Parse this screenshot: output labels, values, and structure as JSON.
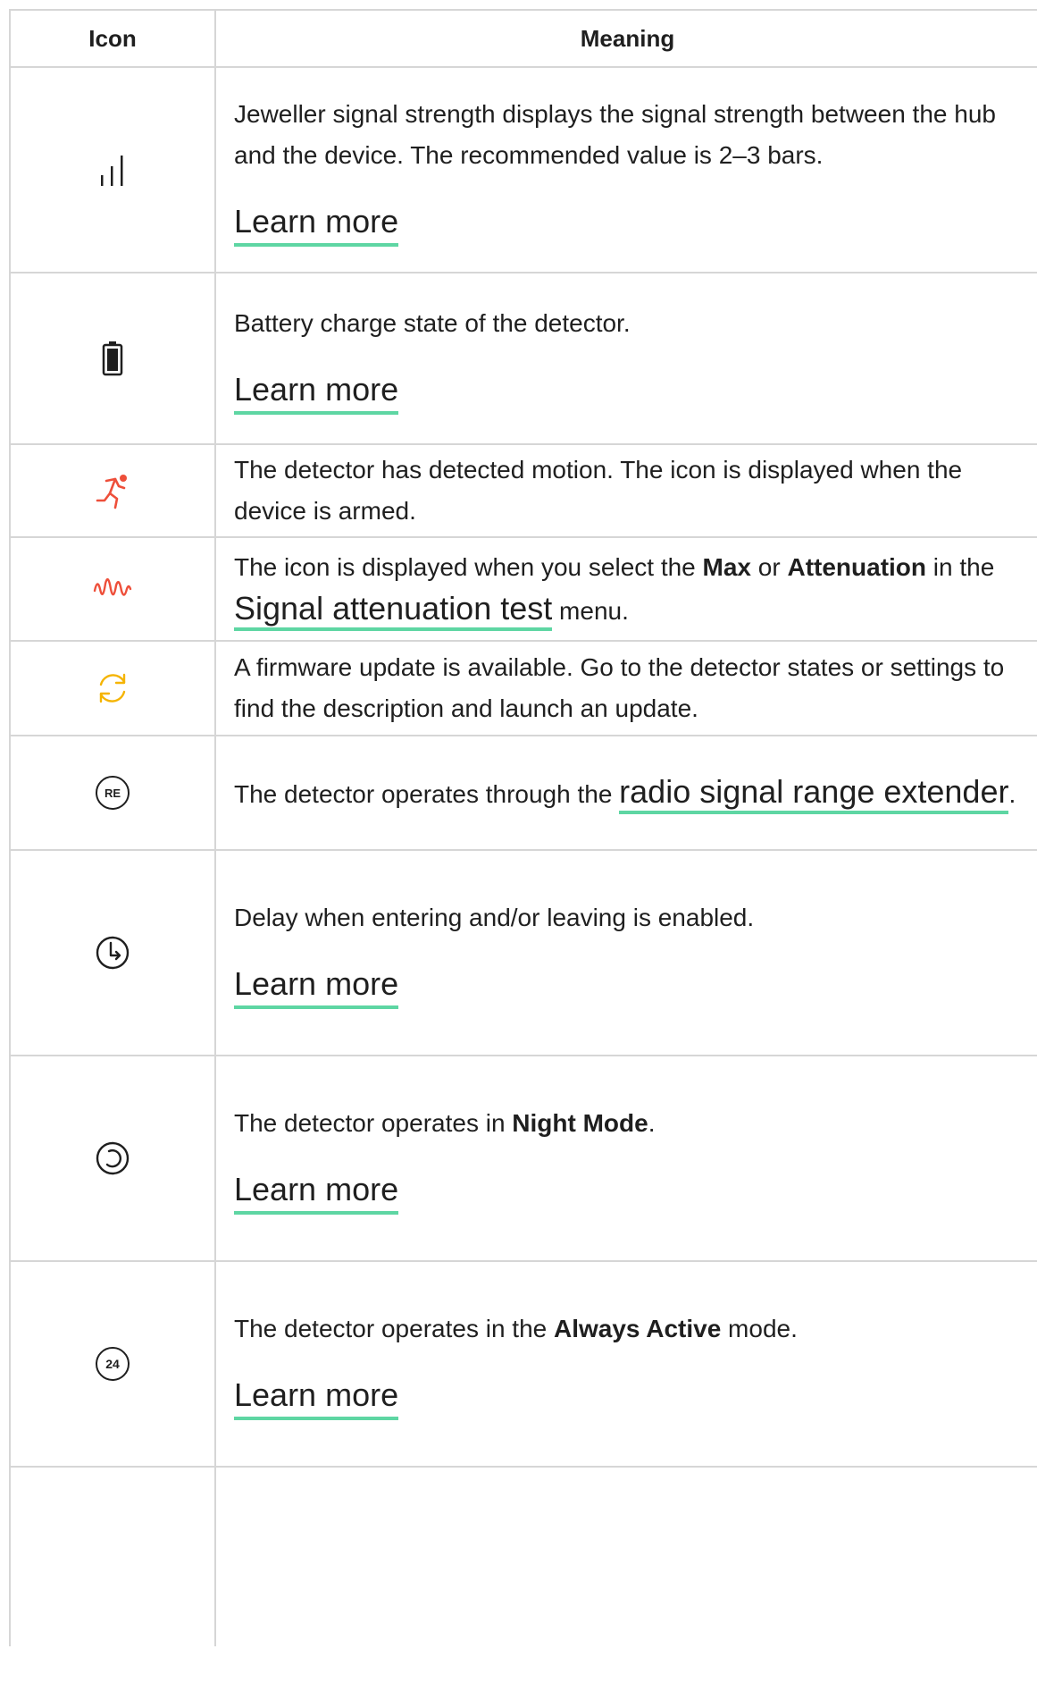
{
  "header": {
    "icon": "Icon",
    "meaning": "Meaning"
  },
  "rows": [
    {
      "icon": "signal-strength-icon",
      "text": "Jeweller signal strength displays the signal strength between the hub and the device. The recommended value is 2–3 bars.",
      "link": "Learn more"
    },
    {
      "icon": "battery-icon",
      "text": "Battery charge state of the detector.",
      "link": "Learn more"
    },
    {
      "icon": "motion-runner-icon",
      "text": "The detector has detected motion. The icon is displayed when the device is armed."
    },
    {
      "icon": "signal-wave-icon",
      "pre": "The icon is displayed when you select the ",
      "b1": "Max",
      "mid": " or ",
      "b2": "Attenuation",
      "mid2": " in the ",
      "link": "Signal attenuation test",
      "post": " menu."
    },
    {
      "icon": "firmware-update-icon",
      "text": "A firmware update is available. Go to the detector states or settings to find the description and launch an update."
    },
    {
      "icon": "range-extender-icon",
      "icon_text": "RE",
      "pre": "The detector operates through the ",
      "link": "radio signal range extender",
      "post": "."
    },
    {
      "icon": "delay-clock-icon",
      "text": "Delay when entering and/or leaving is enabled.",
      "link": "Learn more"
    },
    {
      "icon": "night-mode-icon",
      "pre": "The detector operates in ",
      "bold": "Night Mode",
      "post": ".",
      "link": "Learn more"
    },
    {
      "icon": "always-active-icon",
      "icon_text": "24",
      "pre": "The detector operates in the ",
      "bold": "Always Active",
      "post": " mode.",
      "link": "Learn more"
    }
  ],
  "colors": {
    "border": "#d6d6d6",
    "link_underline": "#5ed6a3",
    "motion_red": "#ee4f3a",
    "update_yellow": "#f5b400"
  }
}
